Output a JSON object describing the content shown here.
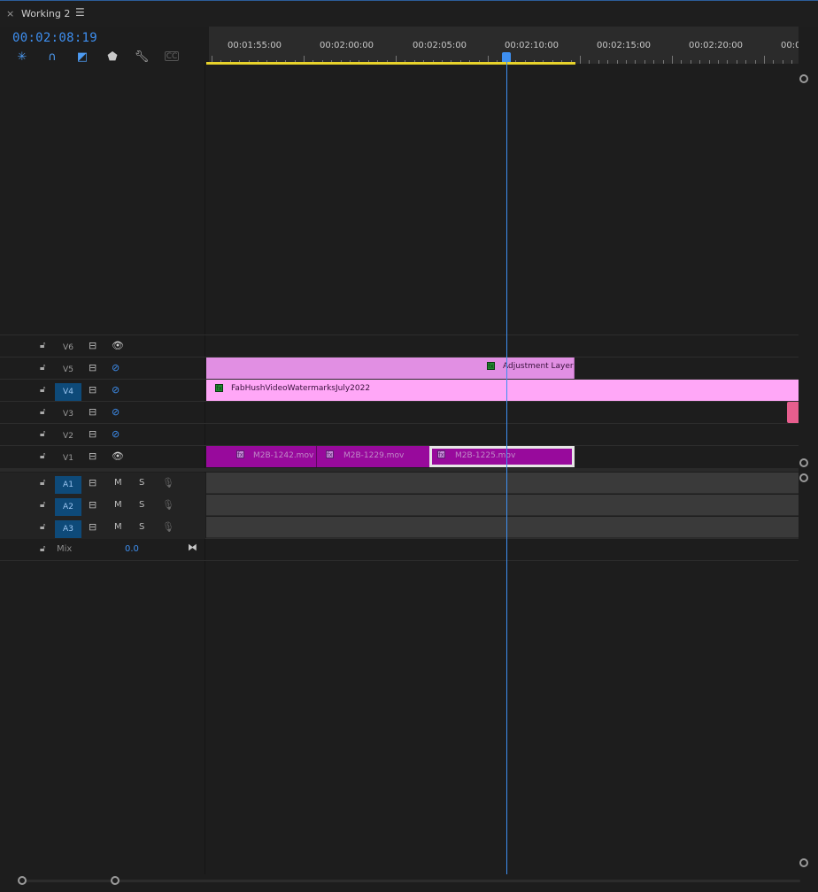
{
  "panel": {
    "close": "×",
    "title": "Working 2",
    "menu": "☰",
    "timecode": "00:02:08:19"
  },
  "ruler": {
    "labels": [
      "00:01:55:00",
      "00:02:00:00",
      "00:02:05:00",
      "00:02:10:00",
      "00:02:15:00",
      "00:02:20:00",
      "00:0"
    ]
  },
  "video_tracks": [
    {
      "name": "V6",
      "targeted": false,
      "visible": true
    },
    {
      "name": "V5",
      "targeted": false,
      "visible": false
    },
    {
      "name": "V4",
      "targeted": true,
      "visible": false
    },
    {
      "name": "V3",
      "targeted": false,
      "visible": false
    },
    {
      "name": "V2",
      "targeted": false,
      "visible": false
    },
    {
      "name": "V1",
      "targeted": false,
      "visible": true
    }
  ],
  "audio_tracks": [
    {
      "name": "A1",
      "mute": "M",
      "solo": "S"
    },
    {
      "name": "A2",
      "mute": "M",
      "solo": "S"
    },
    {
      "name": "A3",
      "mute": "M",
      "solo": "S"
    }
  ],
  "mix": {
    "label": "Mix",
    "value": "0.0"
  },
  "clips": {
    "adjustment": "Adjustment Layer",
    "watermark": "FabHushVideoWatermarksJuly2022",
    "v1_a": "M2B-1242.mov",
    "v1_b": "M2B-1229.mov",
    "v1_c": "M2B-1225.mov"
  },
  "colors": {
    "accent": "#3e8ff0",
    "adjustment_clip": "#e18fe3",
    "watermark_clip": "#ffa7f7",
    "video_clip": "#980a9c",
    "work_area": "#e7d22b"
  }
}
